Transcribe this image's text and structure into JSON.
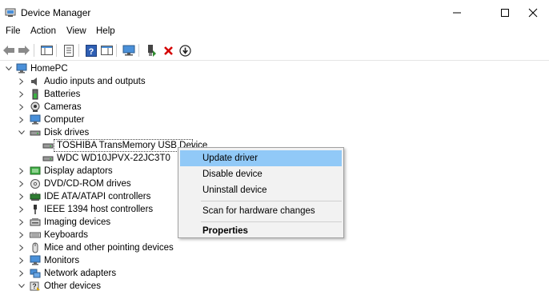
{
  "window": {
    "title": "Device Manager",
    "controls": {
      "minimize": "minimize",
      "maximize": "maximize",
      "close": "close"
    }
  },
  "menu": [
    "File",
    "Action",
    "View",
    "Help"
  ],
  "toolbar": {
    "buttons": [
      "back",
      "forward",
      "show-hide-console-tree",
      "properties",
      "help",
      "action-pane",
      "scan-hardware",
      "add-driver",
      "uninstall",
      "update"
    ]
  },
  "tree": {
    "root": "HomePC",
    "categories": [
      {
        "label": "Audio inputs and outputs",
        "icon": "speaker-icon",
        "expanded": false
      },
      {
        "label": "Batteries",
        "icon": "battery-icon",
        "expanded": false
      },
      {
        "label": "Cameras",
        "icon": "camera-icon",
        "expanded": false
      },
      {
        "label": "Computer",
        "icon": "monitor-icon",
        "expanded": false
      },
      {
        "label": "Disk drives",
        "icon": "disk-icon",
        "expanded": true,
        "children": [
          {
            "label": "TOSHIBA TransMemory USB Device",
            "icon": "disk-icon",
            "selected": true
          },
          {
            "label": "WDC WD10JPVX-22JC3T0",
            "icon": "disk-icon"
          }
        ]
      },
      {
        "label": "Display adaptors",
        "icon": "display-icon",
        "expanded": false
      },
      {
        "label": "DVD/CD-ROM drives",
        "icon": "dvd-icon",
        "expanded": false
      },
      {
        "label": "IDE ATA/ATAPI controllers",
        "icon": "ide-icon",
        "expanded": false
      },
      {
        "label": "IEEE 1394 host controllers",
        "icon": "firewire-icon",
        "expanded": false
      },
      {
        "label": "Imaging devices",
        "icon": "imaging-icon",
        "expanded": false
      },
      {
        "label": "Keyboards",
        "icon": "keyboard-icon",
        "expanded": false
      },
      {
        "label": "Mice and other pointing devices",
        "icon": "mouse-icon",
        "expanded": false
      },
      {
        "label": "Monitors",
        "icon": "monitor-icon",
        "expanded": false
      },
      {
        "label": "Network adapters",
        "icon": "network-icon",
        "expanded": false
      },
      {
        "label": "Other devices",
        "icon": "unknown-device-icon",
        "expanded": true
      }
    ]
  },
  "context_menu": {
    "items": [
      {
        "label": "Update driver",
        "highlighted": true,
        "bold": false
      },
      {
        "label": "Disable device",
        "highlighted": false,
        "bold": false
      },
      {
        "label": "Uninstall device",
        "highlighted": false,
        "bold": false
      },
      {
        "separator": true
      },
      {
        "label": "Scan for hardware changes",
        "highlighted": false,
        "bold": false
      },
      {
        "separator": true
      },
      {
        "label": "Properties",
        "highlighted": false,
        "bold": true
      }
    ]
  },
  "colors": {
    "highlight": "#91c9f7",
    "menu_bg": "#f2f2f2",
    "accent_green": "#2e8b2e",
    "accent_red": "#d40000",
    "icon_blue": "#1f6fc0"
  }
}
